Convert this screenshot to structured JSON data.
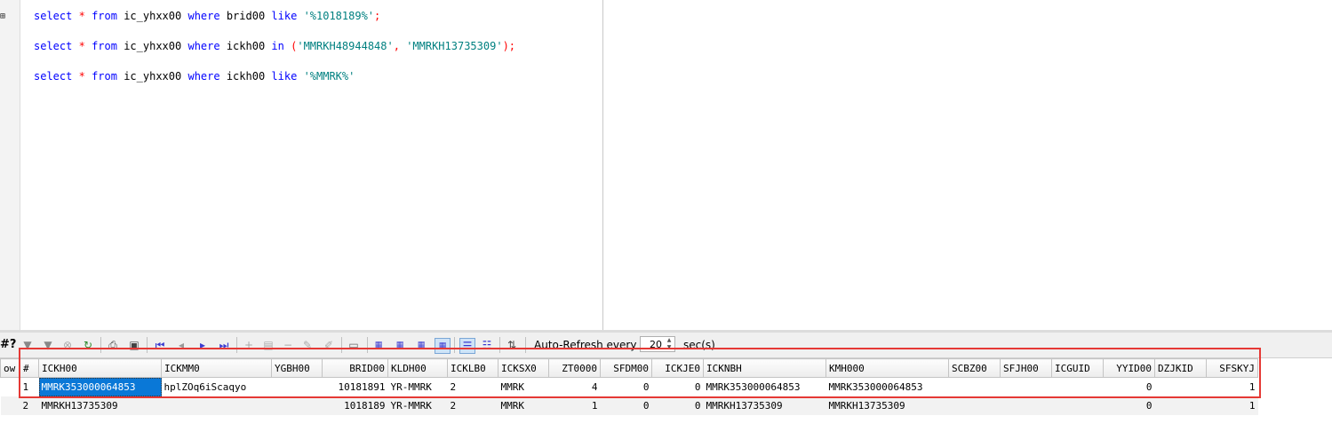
{
  "editor": {
    "fold_marker": "⊞",
    "lines": [
      [
        {
          "t": "kw",
          "v": "select"
        },
        {
          "t": "sp",
          "v": " "
        },
        {
          "t": "op",
          "v": "*"
        },
        {
          "t": "sp",
          "v": " "
        },
        {
          "t": "kw",
          "v": "from"
        },
        {
          "t": "sp",
          "v": " "
        },
        {
          "t": "ident",
          "v": "ic_yhxx00"
        },
        {
          "t": "sp",
          "v": " "
        },
        {
          "t": "kw",
          "v": "where"
        },
        {
          "t": "sp",
          "v": " "
        },
        {
          "t": "ident",
          "v": "brid00"
        },
        {
          "t": "sp",
          "v": " "
        },
        {
          "t": "kw",
          "v": "like"
        },
        {
          "t": "sp",
          "v": " "
        },
        {
          "t": "str",
          "v": "'%1018189%'"
        },
        {
          "t": "op",
          "v": ";"
        }
      ],
      [
        {
          "t": "kw",
          "v": "select"
        },
        {
          "t": "sp",
          "v": " "
        },
        {
          "t": "op",
          "v": "*"
        },
        {
          "t": "sp",
          "v": " "
        },
        {
          "t": "kw",
          "v": "from"
        },
        {
          "t": "sp",
          "v": " "
        },
        {
          "t": "ident",
          "v": "ic_yhxx00"
        },
        {
          "t": "sp",
          "v": " "
        },
        {
          "t": "kw",
          "v": "where"
        },
        {
          "t": "sp",
          "v": " "
        },
        {
          "t": "ident",
          "v": "ickh00"
        },
        {
          "t": "sp",
          "v": " "
        },
        {
          "t": "kw",
          "v": "in"
        },
        {
          "t": "sp",
          "v": " "
        },
        {
          "t": "op",
          "v": "("
        },
        {
          "t": "str",
          "v": "'MMRKH48944848'"
        },
        {
          "t": "op",
          "v": ","
        },
        {
          "t": "sp",
          "v": " "
        },
        {
          "t": "str",
          "v": "'MMRKH13735309'"
        },
        {
          "t": "op",
          "v": ");"
        }
      ],
      [
        {
          "t": "kw",
          "v": "select"
        },
        {
          "t": "sp",
          "v": " "
        },
        {
          "t": "op",
          "v": "*"
        },
        {
          "t": "sp",
          "v": " "
        },
        {
          "t": "kw",
          "v": "from"
        },
        {
          "t": "sp",
          "v": " "
        },
        {
          "t": "ident",
          "v": "ic_yhxx00"
        },
        {
          "t": "sp",
          "v": " "
        },
        {
          "t": "kw",
          "v": "where"
        },
        {
          "t": "sp",
          "v": " "
        },
        {
          "t": "ident",
          "v": "ickh00"
        },
        {
          "t": "sp",
          "v": " "
        },
        {
          "t": "kw",
          "v": "like"
        },
        {
          "t": "sp",
          "v": " "
        },
        {
          "t": "str",
          "v": "'%MMRK%'"
        }
      ]
    ]
  },
  "toolbar": {
    "record_count_label": "#?",
    "auto_refresh_label": "Auto-Refresh every",
    "auto_refresh_value": "20",
    "auto_refresh_unit": "sec(s)"
  },
  "grid": {
    "row_header_label": "ow",
    "row_index_header": "#",
    "columns": [
      "ICKH00",
      "ICKMM0",
      "YGBH00",
      "BRID00",
      "KLDH00",
      "ICKLB0",
      "ICKSX0",
      "ZT0000",
      "SFDM00",
      "ICKJE0",
      "ICKNBH",
      "KMH000",
      "SCBZ00",
      "SFJH00",
      "ICGUID",
      "YYID00",
      "DZJKID",
      "SFSKYJ"
    ],
    "rows": [
      [
        "1",
        "MMRK353000064853",
        "hplZOq6iScaqyo",
        "",
        "10181891",
        "YR-MMRK",
        "2",
        "MMRK",
        "4",
        "0",
        "0",
        "MMRK353000064853",
        "MMRK353000064853",
        "",
        "",
        "",
        "0",
        "",
        "1"
      ],
      [
        "2",
        "MMRKH13735309",
        "",
        "",
        "1018189",
        "YR-MMRK",
        "2",
        "MMRK",
        "1",
        "0",
        "0",
        "MMRKH13735309",
        "MMRKH13735309",
        "",
        "",
        "",
        "0",
        "",
        "1"
      ]
    ],
    "selected_cell": {
      "row": 0,
      "col": 1
    }
  }
}
